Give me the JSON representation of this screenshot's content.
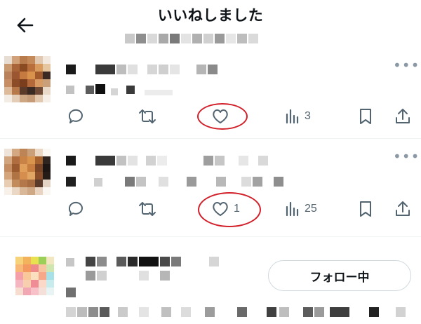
{
  "header": {
    "title": "いいねしました",
    "back_icon": "arrow-left-icon"
  },
  "posts": [
    {
      "more_icon": "more-horizontal-icon",
      "actions": {
        "reply": {
          "icon": "reply-icon",
          "count": ""
        },
        "repost": {
          "icon": "repost-icon",
          "count": ""
        },
        "like": {
          "icon": "heart-icon",
          "count": ""
        },
        "views": {
          "icon": "analytics-icon",
          "count": "3"
        },
        "bookmark": {
          "icon": "bookmark-icon"
        },
        "share": {
          "icon": "share-icon"
        }
      }
    },
    {
      "more_icon": "more-horizontal-icon",
      "actions": {
        "reply": {
          "icon": "reply-icon",
          "count": ""
        },
        "repost": {
          "icon": "repost-icon",
          "count": ""
        },
        "like": {
          "icon": "heart-icon",
          "count": "1"
        },
        "views": {
          "icon": "analytics-icon",
          "count": "25"
        },
        "bookmark": {
          "icon": "bookmark-icon"
        },
        "share": {
          "icon": "share-icon"
        }
      }
    }
  ],
  "user": {
    "follow_label": "フォロー中"
  },
  "colors": {
    "annotation_ring": "#d2202a",
    "icon_gray": "#536471",
    "divider": "#eff3f4"
  }
}
